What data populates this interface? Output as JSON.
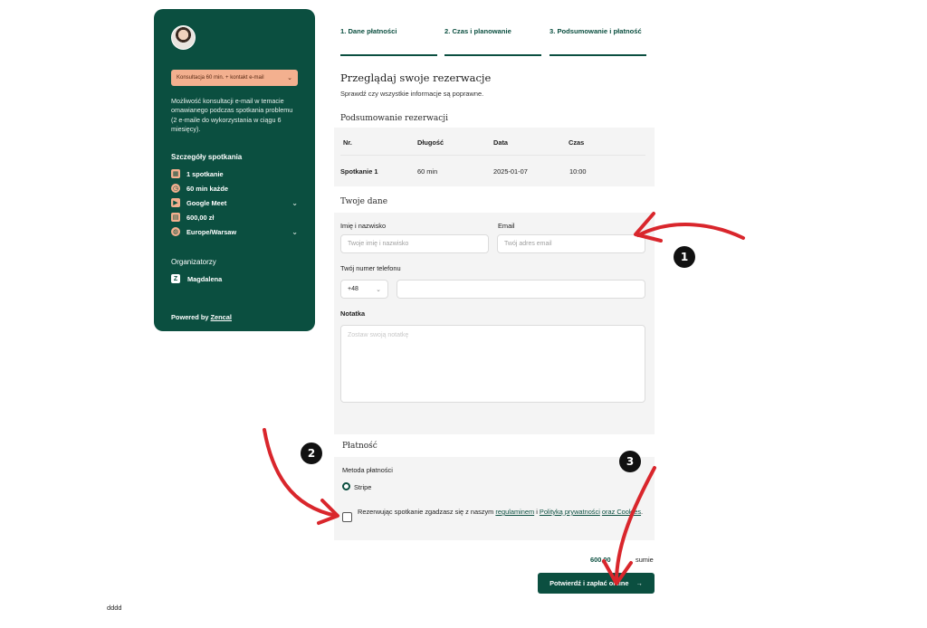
{
  "sidebar": {
    "plan_select": "Konsultacja 60 min. + kontakt e-mail",
    "description": "Możliwość konsultacji e-mail w temacie omawianego podczas spotkania problemu (2 e-maile do wykorzystania w ciągu 6 miesięcy).",
    "details_title": "Szczegóły spotkania",
    "details": {
      "sessions": "1 spotkanie",
      "duration": "60 min każde",
      "platform": "Google Meet",
      "price": "600,00 zł",
      "timezone": "Europe/Warsaw"
    },
    "organizers_title": "Organizatorzy",
    "organizer_name": "Magdalena",
    "organizer_logo": "Z",
    "powered_prefix": "Powered by ",
    "powered_link": "Zencal"
  },
  "steps": [
    {
      "label": "1. Dane płatności"
    },
    {
      "label": "2. Czas i planowanie"
    },
    {
      "label": "3. Podsumowanie i płatność"
    }
  ],
  "main": {
    "title": "Przeglądaj swoje rezerwacje",
    "subtitle": "Sprawdź czy wszystkie informacje są poprawne."
  },
  "summary": {
    "title": "Podsumowanie rezerwacji",
    "headers": [
      "Nr.",
      "Długość",
      "Data",
      "Czas"
    ],
    "row": [
      "Spotkanie 1",
      "60 min",
      "2025-01-07",
      "10:00"
    ]
  },
  "your_data": {
    "title": "Twoje dane",
    "name_label": "Imię i nazwisko",
    "name_placeholder": "Twoje imię i nazwisko",
    "email_label": "Email",
    "email_placeholder": "Twój adres email",
    "phone_label": "Twój numer telefonu",
    "phone_prefix": "+48",
    "note_label": "Notatka",
    "note_placeholder": "Zostaw swoją notatkę"
  },
  "payment": {
    "title": "Płatność",
    "method_label": "Metoda płatności",
    "method_option": "Stripe",
    "consent_prefix": "Rezerwując spotkanie zgadzasz się z naszym ",
    "consent_link_1": "regulaminem",
    "consent_and_1": " i ",
    "consent_link_2": "Polityką prywatności",
    "consent_and_2": " ",
    "consent_link_3": "oraz Cookies",
    "consent_suffix": "."
  },
  "total": {
    "amount": "600,00",
    "suffix": "sumie"
  },
  "submit_label": "Potwierdź i zapłać online",
  "footer": "dddd",
  "annotations": {
    "badges": [
      "1",
      "2",
      "3"
    ],
    "arrow_color": "#d9262c"
  },
  "colors": {
    "brand_green": "#0b4f40",
    "plan_select_bg": "#f3b08f",
    "panel_bg": "#f4f4f4"
  }
}
